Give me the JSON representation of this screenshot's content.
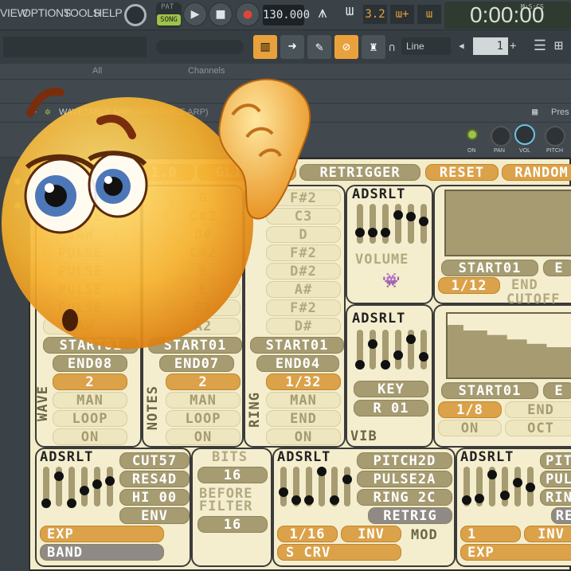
{
  "menu": [
    "VIEW",
    "OPTIONS",
    "TOOLS",
    "HELP"
  ],
  "transport": {
    "pat": "PAT",
    "song": "SONG",
    "play": "▶",
    "stop": "■",
    "rec": "●",
    "tempo": "130.000",
    "time": "0:00:00",
    "time_label": "M:S:CS",
    "pattern_num": "1",
    "snap": "Line"
  },
  "browser": {
    "all": "All",
    "channels": "Channels",
    "preset": "Pres"
  },
  "plugin_title": "WAVETABLE ARP",
  "plugin_sub": "(WAVETABLE ARP)",
  "knobs": [
    "ON",
    "PAN",
    "VOL",
    "PITCH"
  ],
  "header": {
    "manual": "MANUAL",
    "speed": "1.0",
    "glide": "GLIDE00",
    "retrigger": "RETRIGGER",
    "reset": "RESET",
    "random": "RANDOM"
  },
  "wave_col": [
    "SIN",
    "NOISE",
    "SAW",
    "PULSE",
    "PULSE",
    "PULSE",
    "PULSE",
    "SAW",
    "START01",
    "END08",
    "2",
    "MAN",
    "LOOP",
    "ON"
  ],
  "notes_col": [
    "G",
    "C#2",
    "D#",
    "C#2",
    "B",
    "E",
    "E2",
    "A2",
    "START01",
    "END07",
    "2",
    "MAN",
    "LOOP",
    "ON"
  ],
  "ring_col": [
    "F#2",
    "C3",
    "D",
    "F#2",
    "D#2",
    "A#",
    "F#2",
    "D#",
    "START01",
    "END04",
    "1/32",
    "MAN",
    "END",
    "ON"
  ],
  "section_labels": {
    "wave": "WAVE",
    "notes": "NOTES",
    "ring": "RING",
    "vib": "VIB",
    "mod": "MOD",
    "volume": "VOLUME",
    "cutoff": "CUTOFF"
  },
  "adsr": "ADSRLT",
  "vol_panel": {
    "adsr": "ADSRLT",
    "label": "VOLUME"
  },
  "vib_panel": {
    "adsr": "ADSRLT",
    "key": "KEY",
    "r": "R 01",
    "label": "VIB"
  },
  "cut_panel": {
    "start": "START01",
    "e": "E",
    "div": "1/12",
    "end": "END",
    "label": "CUTOFF"
  },
  "cut2_panel": {
    "start": "START01",
    "e": "E",
    "div": "1/8",
    "end": "END",
    "on": "ON",
    "oct": "OCT"
  },
  "filter": {
    "adsr": "ADSRLT",
    "cut": "CUT57",
    "res": "RES4D",
    "hi": "HI 00",
    "env": "ENV",
    "exp": "EXP",
    "band": "BAND"
  },
  "bits": {
    "bits": "BITS",
    "v1": "16",
    "before": "BEFORE",
    "filter": "FILTER",
    "v2": "16"
  },
  "pitch": {
    "adsr": "ADSRLT",
    "pitch": "PITCH2D",
    "pulse": "PULSE2A",
    "ring": "RING 2C",
    "retrig": "RETRIG",
    "div": "1/16",
    "inv": "INV",
    "mod": "MOD",
    "scrv": "S CRV"
  },
  "pitch2": {
    "adsr": "ADSRLT",
    "pi": "PIT",
    "pu": "PUL",
    "ri": "RIN",
    "re": "RE",
    "one": "1",
    "inv": "INV",
    "exp": "EXP"
  },
  "colors": {
    "accent": "#dba24a",
    "chip": "#a69b71",
    "plugin_bg": "#f2ecc8"
  }
}
